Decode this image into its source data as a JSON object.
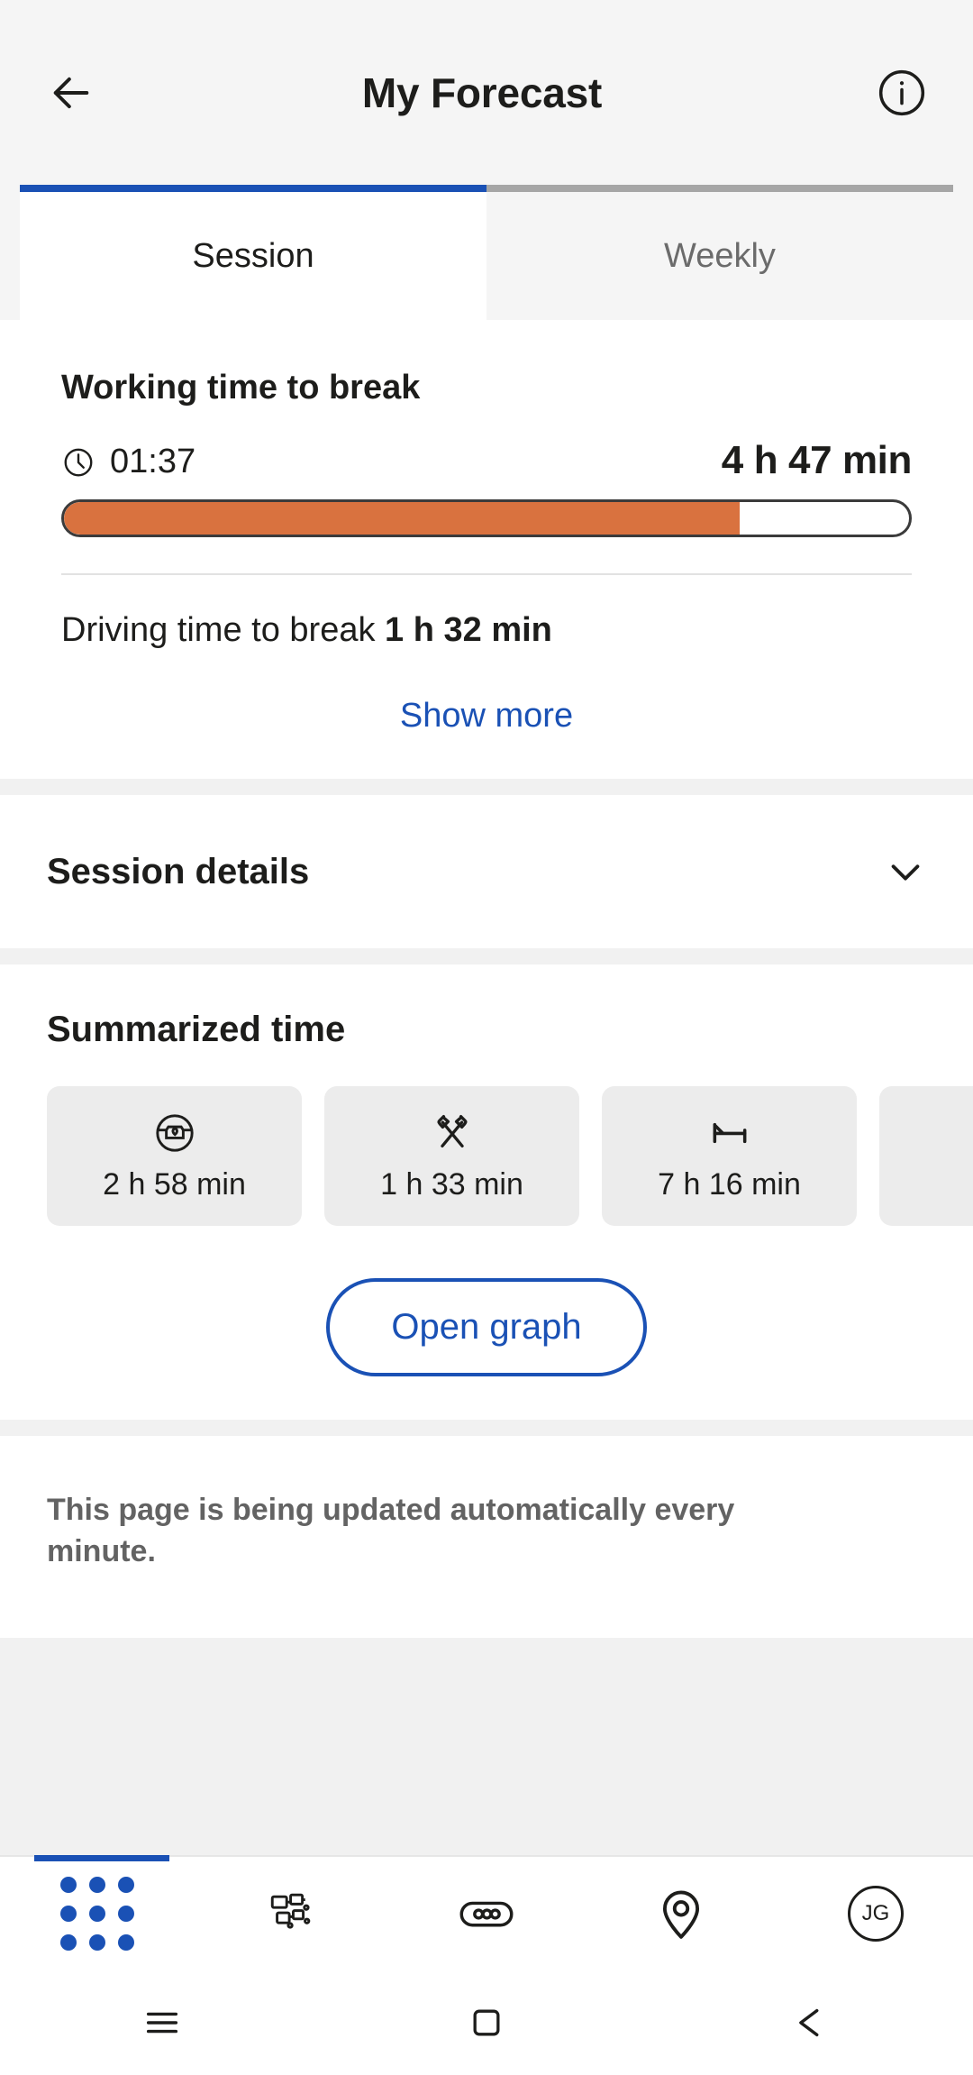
{
  "appbar": {
    "back_icon": "arrow-left-icon",
    "title": "My Forecast",
    "info_icon": "info-circle-icon"
  },
  "tabs": [
    {
      "label": "Session",
      "active": true
    },
    {
      "label": "Weekly",
      "active": false
    }
  ],
  "forecast_card": {
    "title": "Working time to break",
    "clock_icon": "clock-icon",
    "elapsed": "01:37",
    "remaining": "4 h 47 min",
    "progress_percent": 80,
    "progress_color": "#d9723f",
    "driving_label": "Driving time to break",
    "driving_value": "1 h 32 min",
    "show_more": "Show more"
  },
  "session_details": {
    "heading": "Session details",
    "chevron_icon": "chevron-down-icon"
  },
  "summarized": {
    "heading": "Summarized time",
    "tiles": [
      {
        "icon": "steering-wheel-icon",
        "value": "2 h 58 min"
      },
      {
        "icon": "crossed-tools-icon",
        "value": "1 h 33 min"
      },
      {
        "icon": "bed-icon",
        "value": "7 h 16 min"
      }
    ],
    "open_graph": "Open graph"
  },
  "note": {
    "text": "This page is being updated automatically every minute."
  },
  "bottom_nav": {
    "accent_color": "#1a51b5",
    "items": [
      {
        "icon": "apps-grid-icon",
        "active": true
      },
      {
        "icon": "vehicles-icon",
        "active": false
      },
      {
        "icon": "tachograph-icon",
        "active": false
      },
      {
        "icon": "location-pin-icon",
        "active": false
      },
      {
        "icon": "avatar-icon",
        "label": "JG",
        "active": false
      }
    ]
  },
  "system_nav": {
    "items": [
      {
        "icon": "menu-icon"
      },
      {
        "icon": "home-square-icon"
      },
      {
        "icon": "back-triangle-icon"
      }
    ]
  }
}
